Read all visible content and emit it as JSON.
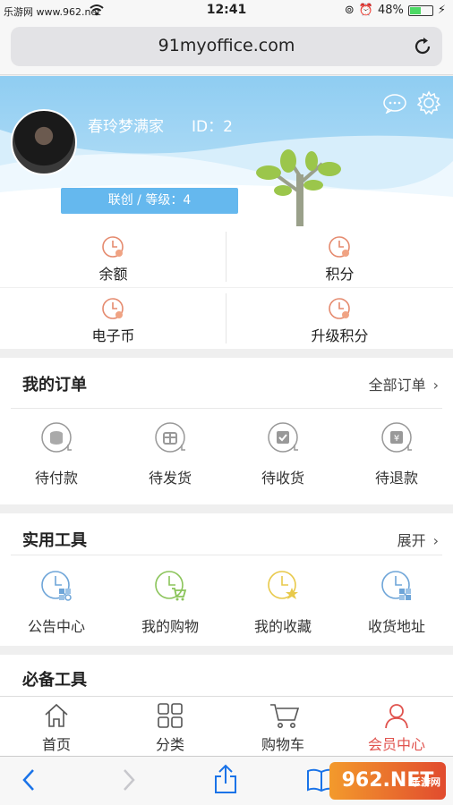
{
  "status_bar": {
    "carrier": "乐游网 www.962.net",
    "time": "12:41",
    "battery": "48%",
    "battery_level": 0.48
  },
  "browser": {
    "url": "91myoffice.com"
  },
  "profile": {
    "name": "春玲梦满家",
    "id_text": "ID：2",
    "level_text": "联创 / 等级：4"
  },
  "assets": [
    {
      "label": "余额"
    },
    {
      "label": "积分"
    },
    {
      "label": "电子币"
    },
    {
      "label": "升级积分"
    }
  ],
  "orders": {
    "title": "我的订单",
    "more_label": "全部订单",
    "items": [
      {
        "label": "待付款",
        "icon": "coins-icon"
      },
      {
        "label": "待发货",
        "icon": "gift-icon"
      },
      {
        "label": "待收货",
        "icon": "check-box-icon"
      },
      {
        "label": "待退款",
        "icon": "yen-icon"
      }
    ]
  },
  "tools": {
    "title": "实用工具",
    "more_label": "展开",
    "items": [
      {
        "label": "公告中心",
        "icon": "notice-icon"
      },
      {
        "label": "我的购物",
        "icon": "cart-icon"
      },
      {
        "label": "我的收藏",
        "icon": "star-icon"
      },
      {
        "label": "收货地址",
        "icon": "address-icon"
      }
    ]
  },
  "essentials": {
    "title": "必备工具"
  },
  "tabbar": [
    {
      "label": "首页",
      "icon": "home-icon"
    },
    {
      "label": "分类",
      "icon": "grid-icon"
    },
    {
      "label": "购物车",
      "icon": "cart-icon"
    },
    {
      "label": "会员中心",
      "icon": "user-icon",
      "active": true
    }
  ],
  "watermark": {
    "text": "962.NET",
    "sub": "乐游网"
  },
  "colors": {
    "accent": "#e0534e",
    "banner": "#8fcdf2",
    "level_bar": "#65b8ee"
  }
}
